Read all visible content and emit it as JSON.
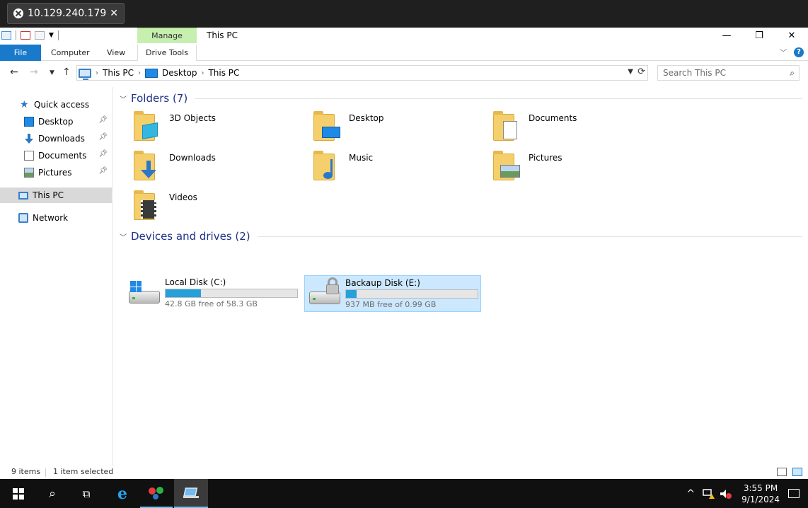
{
  "rdp": {
    "host": "10.129.240.179",
    "close": "✕"
  },
  "window": {
    "title": "This PC",
    "context_tab_group": "Manage",
    "controls": {
      "minimize": "—",
      "restore": "❐",
      "close": "✕"
    }
  },
  "ribbon": {
    "tabs": [
      "File",
      "Computer",
      "View",
      "Drive Tools"
    ],
    "help": "?"
  },
  "address": {
    "crumbs": [
      "This PC",
      "Desktop",
      "This PC"
    ],
    "search_placeholder": "Search This PC"
  },
  "nav": {
    "quick_access": "Quick access",
    "items": [
      "Desktop",
      "Downloads",
      "Documents",
      "Pictures"
    ],
    "this_pc": "This PC",
    "network": "Network"
  },
  "groups": {
    "folders": "Folders (7)",
    "drives": "Devices and drives (2)"
  },
  "folders": [
    "3D Objects",
    "Desktop",
    "Documents",
    "Downloads",
    "Music",
    "Pictures",
    "Videos"
  ],
  "drives": [
    {
      "name": "Local Disk (C:)",
      "free": "42.8 GB free of 58.3 GB",
      "used_fraction": 0.27
    },
    {
      "name": "Backaup Disk (E:)",
      "free": "937 MB free of 0.99 GB",
      "used_fraction": 0.08
    }
  ],
  "status": {
    "items": "9 items",
    "selected": "1 item selected"
  },
  "taskbar": {
    "time": "3:55 PM",
    "date": "9/1/2024"
  },
  "colors": {
    "accent": "#1979ca",
    "drive_bar": "#26a0da",
    "selection": "#cce8ff"
  }
}
